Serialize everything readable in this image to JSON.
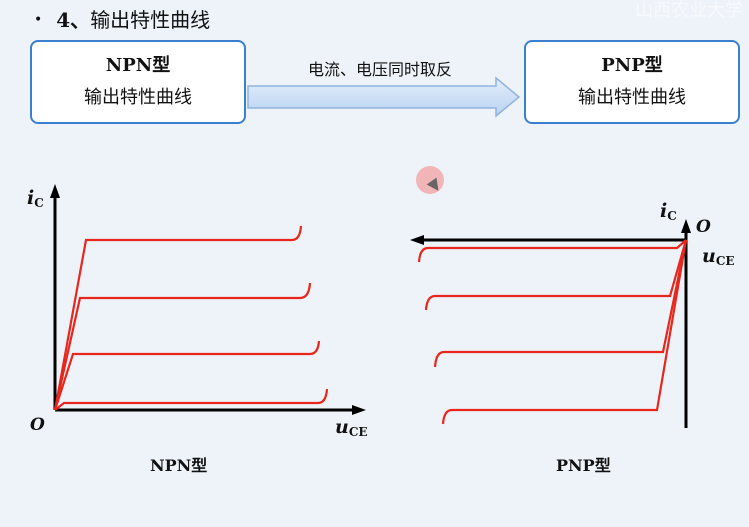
{
  "watermark": "山西农业大学",
  "title": {
    "bullet": "•",
    "number": "4、",
    "text": "输出特性曲线"
  },
  "npn_box": {
    "line1": "NPN型",
    "line2": "输出特性曲线"
  },
  "pnp_box": {
    "line1": "PNP型",
    "line2": "输出特性曲线"
  },
  "transform_arrow": {
    "label": "电流、电压同时取反"
  },
  "npn_chart": {
    "y_axis": {
      "symbol": "i",
      "subscript": "C"
    },
    "x_axis": {
      "symbol": "u",
      "subscript": "CE"
    },
    "origin": "O",
    "curve_count": 4,
    "caption": "NPN型"
  },
  "pnp_chart": {
    "y_axis": {
      "symbol": "i",
      "subscript": "C"
    },
    "x_axis": {
      "symbol": "u",
      "subscript": "CE"
    },
    "origin": "O",
    "curve_count": 4,
    "caption": "PNP型"
  },
  "colors": {
    "curve": "#e8261c",
    "box_border": "#3a7fd0",
    "arrow_fill": "#c9dcf4",
    "arrow_stroke": "#8fb3e0"
  }
}
